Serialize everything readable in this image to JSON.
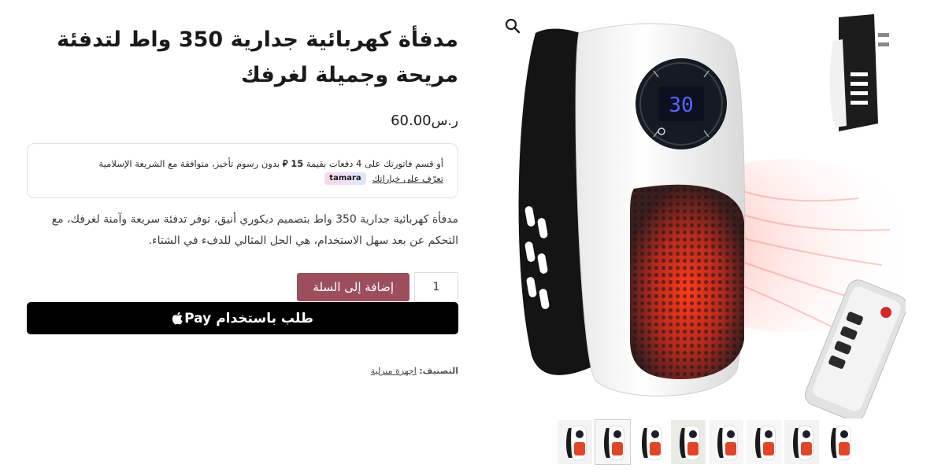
{
  "product": {
    "title": "مدفأة كهربائية جدارية 350 واط لتدفئة مريحة وجميلة لغرفك",
    "price_value": "60.00",
    "price_currency": "ر.س",
    "description": "مدفأة كهربائية جدارية 350 واط بتصميم ديكوري أنيق، توفر تدفئة سريعة وآمنة لغرفك، مع التحكم عن بعد سهل الاستخدام، هي الحل المثالي للدفء في الشتاء."
  },
  "tamara": {
    "line_prefix": "أو قسم فاتورتك على 4 دفعات بقيمة",
    "amount": "15",
    "currency_symbol": "⃁",
    "line_suffix": "بدون رسوم تأخير، متوافقة مع الشريعة الإسلامية",
    "link_text": "تعرّف على خياراتك",
    "logo_text": "tamara"
  },
  "cart": {
    "quantity": "1",
    "add_to_cart_label": "إضافة إلى السلة"
  },
  "applepay": {
    "label": "طلب باستخدام",
    "brand": "Pay"
  },
  "meta": {
    "category_label": "التصنيف:",
    "category_value": "اجهزة منزلية"
  },
  "gallery": {
    "zoom_icon": "search-icon",
    "display_digits": "30",
    "thumbnail_count": 8,
    "active_thumbnail": 1
  },
  "colors": {
    "add_to_cart": "#9c4e5d",
    "applepay_bg": "#000000",
    "heater_glow": "#e0452a"
  }
}
